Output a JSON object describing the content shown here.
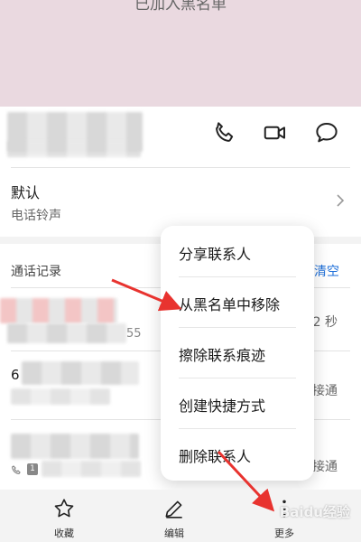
{
  "header": {
    "blacklist_status": "已加入黑名单"
  },
  "ringtone": {
    "title": "默认",
    "subtitle": "电话铃声"
  },
  "calls": {
    "title": "通话记录",
    "clear_label": "清空",
    "row1_right": "2 秒",
    "row2_right": "接通",
    "row3_right": "接通",
    "row1_partial": "55",
    "row2_partial": "6",
    "row3_badge": "1"
  },
  "menu": {
    "items": [
      "分享联系人",
      "从黑名单中移除",
      "擦除联系痕迹",
      "创建快捷方式",
      "删除联系人"
    ]
  },
  "bottom": {
    "favorite": "收藏",
    "edit": "编辑",
    "more": "更多"
  },
  "watermark": "Baidu经验",
  "colors": {
    "accent": "#1e6fd9",
    "arrow": "#e8332f",
    "header_bg": "#ead9e0"
  }
}
